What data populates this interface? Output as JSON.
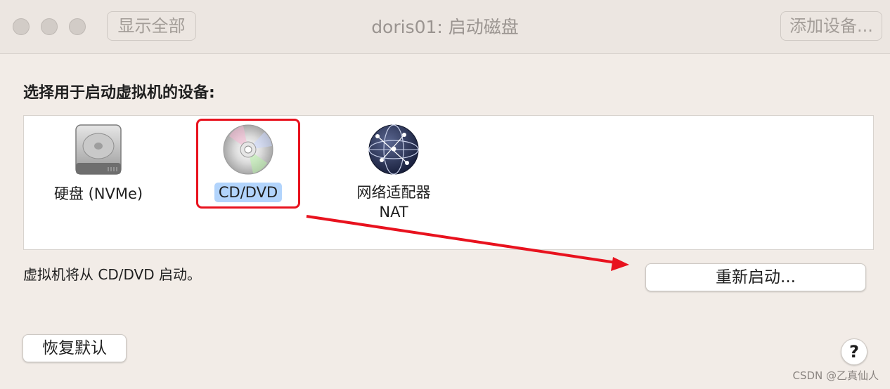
{
  "window": {
    "title": "doris01: 启动磁盘",
    "show_all_label": "显示全部",
    "add_device_label": "添加设备..."
  },
  "prompt": "选择用于启动虚拟机的设备:",
  "devices": [
    {
      "label": "硬盘 (NVMe)",
      "icon": "hard-drive-icon",
      "selected": false
    },
    {
      "label": "CD/DVD",
      "icon": "cd-dvd-icon",
      "selected": true
    },
    {
      "label": "网络适配器",
      "sublabel": "NAT",
      "icon": "network-globe-icon",
      "selected": false
    }
  ],
  "status": "虚拟机将从 CD/DVD 启动。",
  "restart_label": "重新启动...",
  "restore_defaults_label": "恢复默认",
  "help_label": "?",
  "watermark": "CSDN @乙真仙人",
  "colors": {
    "annotation": "#e8121e",
    "selection": "#b2d4fc"
  }
}
